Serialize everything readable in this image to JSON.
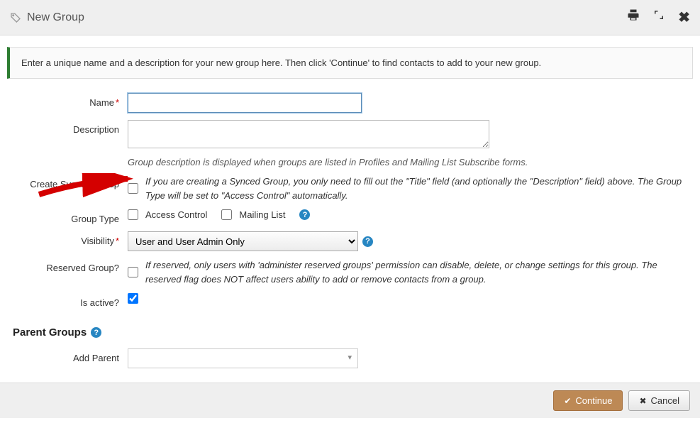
{
  "header": {
    "title": "New Group"
  },
  "banner": {
    "text": "Enter a unique name and a description for your new group here. Then click 'Continue' to find contacts to add to your new group."
  },
  "form": {
    "name": {
      "label": "Name",
      "value": ""
    },
    "description": {
      "label": "Description",
      "value": "",
      "help": "Group description is displayed when groups are listed in Profiles and Mailing List Subscribe forms."
    },
    "synced": {
      "label": "Create Synced Group",
      "checked": false,
      "help": "If you are creating a Synced Group, you only need to fill out the \"Title\" field (and optionally the \"Description\" field) above. The Group Type will be set to \"Access Control\" automatically."
    },
    "group_type": {
      "label": "Group Type",
      "access_control": {
        "label": "Access Control",
        "checked": false
      },
      "mailing_list": {
        "label": "Mailing List",
        "checked": false
      }
    },
    "visibility": {
      "label": "Visibility",
      "selected": "User and User Admin Only"
    },
    "reserved": {
      "label": "Reserved Group?",
      "checked": false,
      "help": "If reserved, only users with 'administer reserved groups' permission can disable, delete, or change settings for this group. The reserved flag does NOT affect users ability to add or remove contacts from a group."
    },
    "active": {
      "label": "Is active?",
      "checked": true
    }
  },
  "parent_groups": {
    "title": "Parent Groups",
    "add_parent": {
      "label": "Add Parent",
      "selected": ""
    }
  },
  "footer": {
    "continue": "Continue",
    "cancel": "Cancel"
  }
}
